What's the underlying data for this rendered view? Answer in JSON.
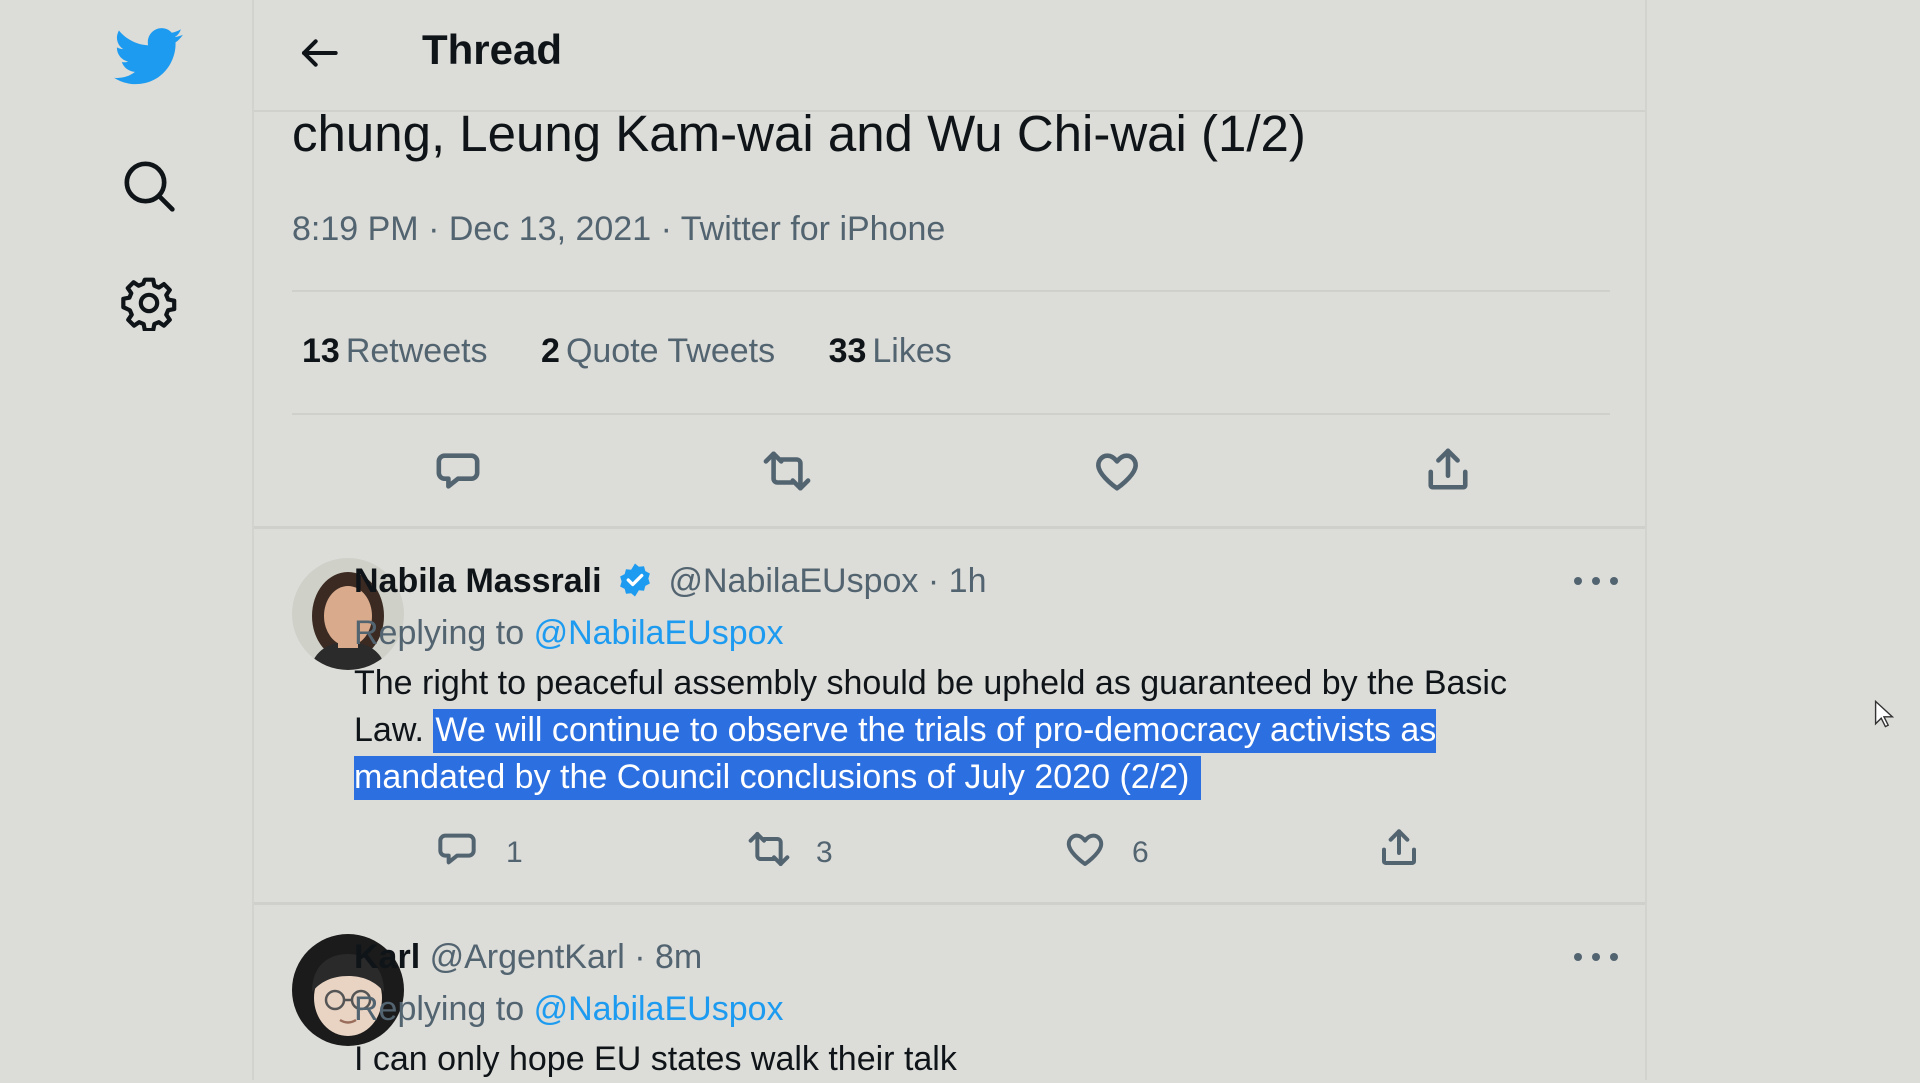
{
  "nav": {
    "icons": [
      "twitter-bird-icon",
      "search-icon",
      "gear-icon"
    ],
    "brand_color": "#1d9bf0"
  },
  "header": {
    "title": "Thread"
  },
  "main_tweet": {
    "text_tail": "chung, Leung Kam-wai and Wu Chi-wai (1/2)",
    "time": "8:19 PM",
    "date": "Dec 13, 2021",
    "source": "Twitter for iPhone",
    "separator": "·",
    "stats": [
      {
        "count": "13",
        "label": "Retweets"
      },
      {
        "count": "2",
        "label": "Quote Tweets"
      },
      {
        "count": "33",
        "label": "Likes"
      }
    ]
  },
  "replies": [
    {
      "name": "Nabila Massrali",
      "verified": true,
      "handle": "@NabilaEUspox",
      "time_sep": "·",
      "time": "1h",
      "replying_prefix": "Replying to",
      "replying_to": "@NabilaEUspox",
      "text_plain": "The right to peaceful assembly should be upheld as guaranteed by the Basic Law. ",
      "text_highlighted": "We will continue to observe the trials of pro-democracy activists as mandated by the Council conclusions of July 2020 (2/2)",
      "reply_count": "1",
      "retweet_count": "3",
      "like_count": "6"
    },
    {
      "name": "Karl",
      "handle": "@ArgentKarl",
      "time_sep": "·",
      "time": "8m",
      "replying_prefix": "Replying to",
      "replying_to": "@NabilaEUspox",
      "text_plain": "I can only hope EU states walk their talk"
    }
  ],
  "colors": {
    "background": "#dcdcd8",
    "accent": "#1d9bf0",
    "selection_highlight": "#2c6fe0",
    "secondary_text": "#536471"
  }
}
